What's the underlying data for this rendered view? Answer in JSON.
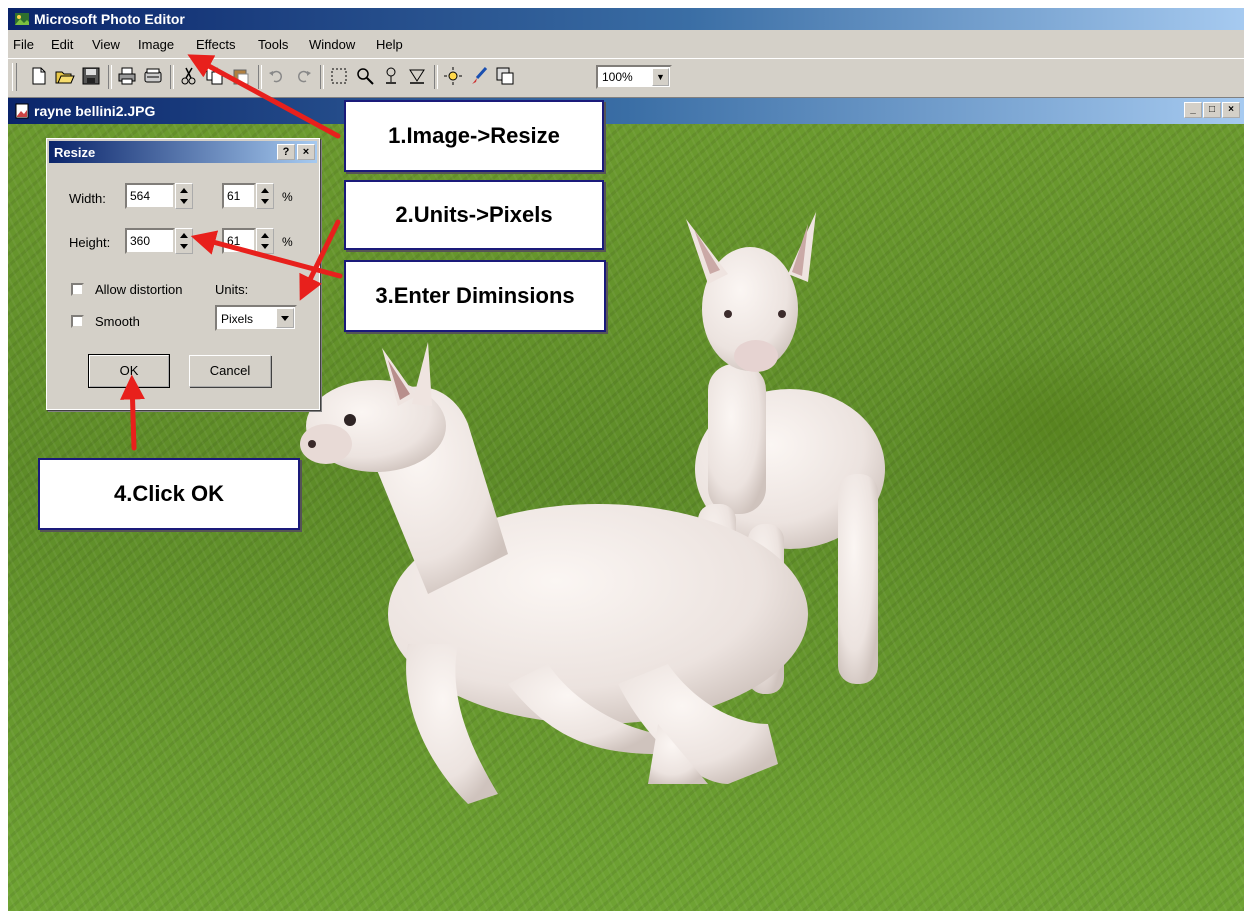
{
  "app": {
    "title": "Microsoft Photo Editor"
  },
  "menu": [
    "File",
    "Edit",
    "View",
    "Image",
    "Effects",
    "Tools",
    "Window",
    "Help"
  ],
  "toolbar": {
    "zoom": "100%"
  },
  "document": {
    "title": "rayne bellini2.JPG",
    "minimize": "_",
    "maximize": "□",
    "close": "×"
  },
  "dialog": {
    "title": "Resize",
    "help_btn": "?",
    "close_btn": "×",
    "width_label": "Width:",
    "width_value": "564",
    "width_pct": "61",
    "height_label": "Height:",
    "height_value": "360",
    "height_pct": "61",
    "pct_symbol": "%",
    "allow_distortion": "Allow distortion",
    "smooth": "Smooth",
    "units_label": "Units:",
    "units_value": "Pixels",
    "ok": "OK",
    "cancel": "Cancel"
  },
  "callouts": {
    "step1": "1.Image->Resize",
    "step2": "2.Units->Pixels",
    "step3": "3.Enter Diminsions",
    "step4": "4.Click OK"
  },
  "colors": {
    "titlebar": "#0a246a",
    "face": "#d4d0c8",
    "arrow": "#e8201c",
    "callout_border": "#1a1a7a",
    "grass": "#5e8c28"
  }
}
